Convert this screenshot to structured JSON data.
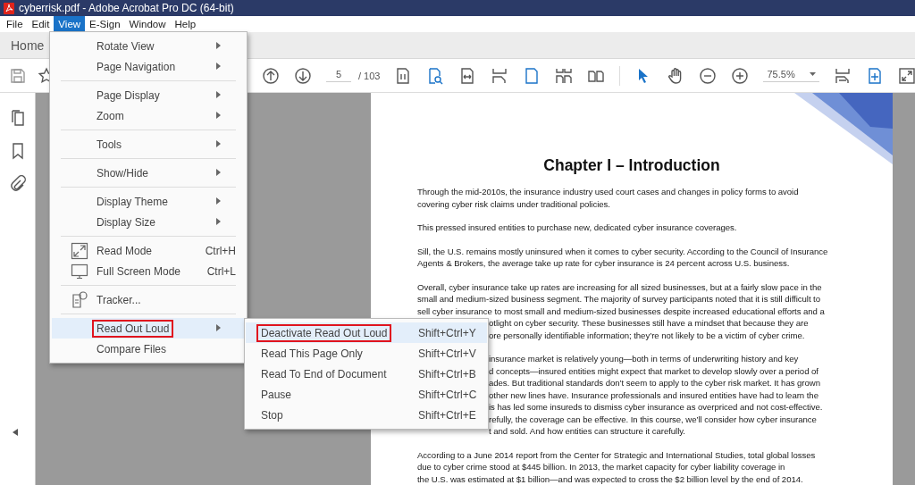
{
  "window": {
    "title": "cyberrisk.pdf - Adobe Acrobat Pro DC (64-bit)"
  },
  "menu_bar": [
    {
      "label": "File",
      "selected": false
    },
    {
      "label": "Edit",
      "selected": false
    },
    {
      "label": "View",
      "selected": true
    },
    {
      "label": "E-Sign",
      "selected": false
    },
    {
      "label": "Window",
      "selected": false
    },
    {
      "label": "Help",
      "selected": false
    }
  ],
  "home_tab": {
    "label": "Home"
  },
  "toolbar": {
    "page_number": "5",
    "page_total": "/ 103",
    "zoom": "75.5%"
  },
  "view_menu": {
    "items": [
      {
        "kind": "item",
        "label": "Rotate View",
        "submenu": true,
        "selected": false,
        "outlined": false
      },
      {
        "kind": "item",
        "label": "Page Navigation",
        "submenu": true,
        "selected": false,
        "outlined": false
      },
      {
        "kind": "separator"
      },
      {
        "kind": "item",
        "label": "Page Display",
        "submenu": true,
        "selected": false,
        "outlined": false
      },
      {
        "kind": "item",
        "label": "Zoom",
        "submenu": true,
        "selected": false,
        "outlined": false
      },
      {
        "kind": "separator"
      },
      {
        "kind": "item",
        "label": "Tools",
        "submenu": true,
        "selected": false,
        "outlined": false
      },
      {
        "kind": "separator"
      },
      {
        "kind": "item",
        "label": "Show/Hide",
        "submenu": true,
        "selected": false,
        "outlined": false
      },
      {
        "kind": "separator"
      },
      {
        "kind": "item",
        "label": "Display Theme",
        "submenu": true,
        "selected": false,
        "outlined": false
      },
      {
        "kind": "item",
        "label": "Display Size",
        "submenu": true,
        "selected": false,
        "outlined": false
      },
      {
        "kind": "separator"
      },
      {
        "kind": "iconitem",
        "label": "Read Mode",
        "shortcut": "Ctrl+H",
        "submenu": false,
        "selected": false,
        "outlined": false
      },
      {
        "kind": "iconitem",
        "label": "Full Screen Mode",
        "shortcut": "Ctrl+L",
        "submenu": false,
        "selected": false,
        "outlined": false
      },
      {
        "kind": "separator"
      },
      {
        "kind": "iconitem",
        "label": "Tracker...",
        "submenu": false,
        "selected": false,
        "outlined": false
      },
      {
        "kind": "separator"
      },
      {
        "kind": "item",
        "label": "Read Out Loud",
        "submenu": true,
        "selected": true,
        "outlined": true
      },
      {
        "kind": "item",
        "label": "Compare Files",
        "submenu": false,
        "selected": false,
        "outlined": false
      }
    ]
  },
  "read_out_loud_submenu": {
    "items": [
      {
        "label": "Deactivate Read Out Loud",
        "shortcut": "Shift+Ctrl+Y",
        "selected": true,
        "outlined": true
      },
      {
        "label": "Read This Page Only",
        "shortcut": "Shift+Ctrl+V",
        "selected": false,
        "outlined": false
      },
      {
        "label": "Read To End of Document",
        "shortcut": "Shift+Ctrl+B",
        "selected": false,
        "outlined": false
      },
      {
        "label": "Pause",
        "shortcut": "Shift+Ctrl+C",
        "selected": false,
        "outlined": false
      },
      {
        "label": "Stop",
        "shortcut": "Shift+Ctrl+E",
        "selected": false,
        "outlined": false
      }
    ]
  },
  "document": {
    "heading": "Chapter I – Introduction",
    "paragraphs": [
      {
        "lines": [
          "Through the mid-2010s, the insurance industry used court cases and changes in policy forms to avoid",
          "covering cyber risk claims under traditional policies."
        ]
      },
      {
        "lines": [
          "This pressed insured entities to purchase new, dedicated cyber insurance coverages."
        ]
      },
      {
        "lines": [
          "Sill, the U.S. remains mostly uninsured when it comes to cyber security. According to the Council of Insurance",
          "Agents & Brokers, the average take up rate for cyber insurance is 24 percent across U.S. business."
        ]
      },
      {
        "lines": [
          "Overall, cyber insurance take up rates are increasing for all sized businesses, but at a fairly slow pace in the",
          "small and medium-sized business segment. The majority of survey participants noted that it is still difficult to",
          "sell cyber insurance to most small and medium-sized businesses despite increased educational efforts and a"
        ],
        "partial_lines": [
          "otlight on cyber security. These businesses still have a mindset that because they are",
          "ore personally identifiable information; they’re not likely to be a victim of cyber crime."
        ]
      },
      {
        "partial_lines": [
          "insurance market is relatively young—both in terms of underwriting history and key",
          "d concepts—insured entities might expect that market to develop slowly over a period of",
          "ades. But traditional standards don’t seem to apply to the cyber risk market. It has grown",
          "other new lines have. Insurance professionals and insured entities have had to learn the",
          "is has led some insureds to dismiss cyber insurance as overpriced and not cost-effective.",
          "refully, the coverage can be effective. In this course, we’ll consider how cyber insurance",
          "t and sold. And how entities can structure it carefully."
        ]
      },
      {
        "lines": [
          "According to a June 2014 report from the Center for Strategic and International Studies, total global losses",
          "due to cyber crime stood at $445 billion. In 2013, the market capacity for cyber liability coverage in",
          "the U.S. was estimated at $1 billion—and was expected to cross the $2 billion level by the end of 2014."
        ]
      }
    ]
  }
}
